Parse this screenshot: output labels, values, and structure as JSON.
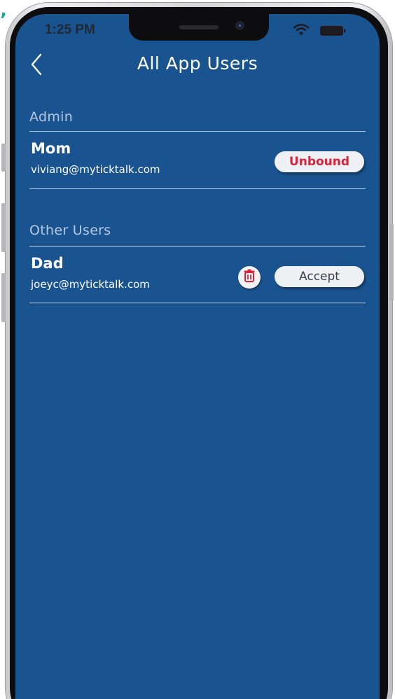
{
  "decoration": {
    "stray_mark": "’"
  },
  "status_bar": {
    "time": "1:25 PM",
    "icons": [
      "wifi-icon",
      "battery-icon"
    ]
  },
  "nav": {
    "back_icon": "chevron-left-icon",
    "title": "All App Users"
  },
  "sections": {
    "admin": {
      "header": "Admin",
      "users": [
        {
          "name": "Mom",
          "email": "viviang@myticktalk.com",
          "action_label": "Unbound"
        }
      ]
    },
    "other": {
      "header": "Other Users",
      "users": [
        {
          "name": "Dad",
          "email": "joeyc@myticktalk.com",
          "delete_icon": "trash-icon",
          "action_label": "Accept"
        }
      ]
    }
  },
  "colors": {
    "screen_background": "#1a5490",
    "divider": "#b6c8e0",
    "unbound_text": "#d8243c",
    "accept_text": "#3b3f48",
    "delete_icon": "#d8243c",
    "button_background": "#eef0f4"
  }
}
